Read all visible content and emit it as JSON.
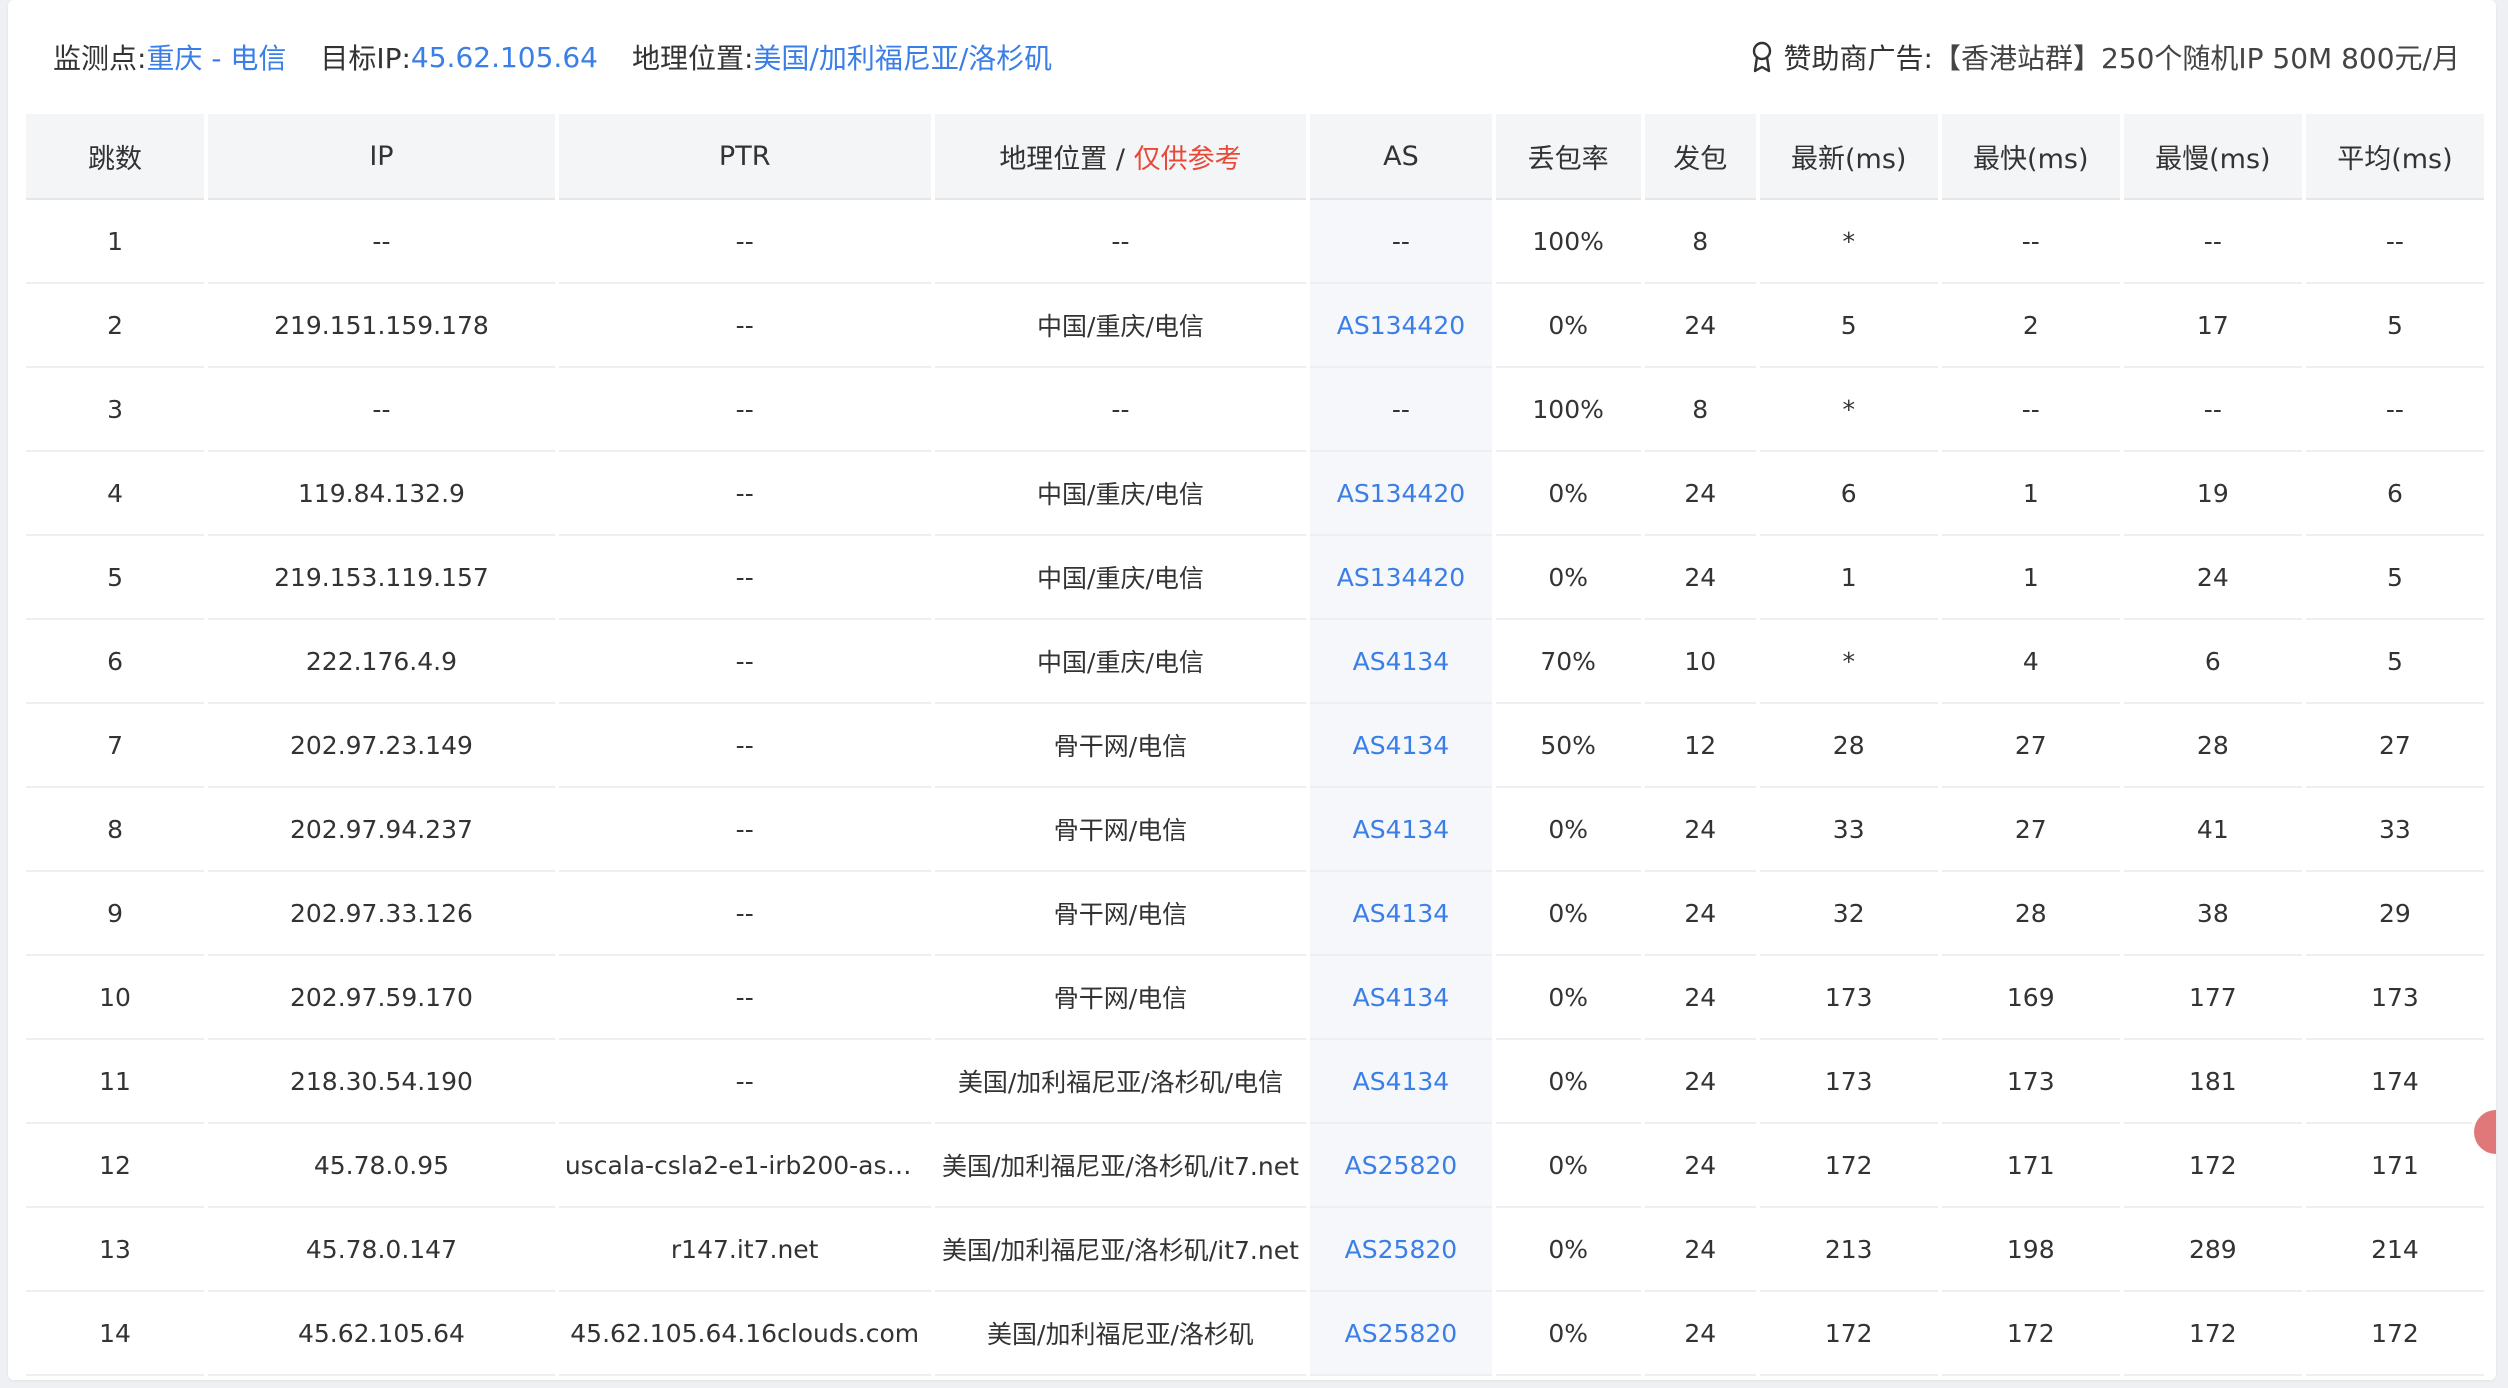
{
  "header": {
    "monitor_label": "监测点:",
    "monitor_value": "重庆 - 电信",
    "target_label": "目标IP:",
    "target_value": "45.62.105.64",
    "geo_label": "地理位置:",
    "geo_value": "美国/加利福尼亚/洛杉矶",
    "sponsor_label": "赞助商广告:",
    "sponsor_text": "【香港站群】250个随机IP 50M 800元/月",
    "icon": "award-icon"
  },
  "columns": {
    "hop": "跳数",
    "ip": "IP",
    "ptr": "PTR",
    "geo": "地理位置 / ",
    "geo_note": "仅供参考",
    "as": "AS",
    "loss": "丢包率",
    "sent": "发包",
    "last": "最新(ms)",
    "best": "最快(ms)",
    "worst": "最慢(ms)",
    "avg": "平均(ms)"
  },
  "colors": {
    "link": "#3a7ee8",
    "note_red": "#e84a3a"
  },
  "rows": [
    {
      "hop": "1",
      "ip": "--",
      "ptr": "--",
      "geo": "--",
      "as": "--",
      "as_link": false,
      "loss": "100%",
      "sent": "8",
      "last": "*",
      "best": "--",
      "worst": "--",
      "avg": "--"
    },
    {
      "hop": "2",
      "ip": "219.151.159.178",
      "ptr": "--",
      "geo": "中国/重庆/电信",
      "as": "AS134420",
      "as_link": true,
      "loss": "0%",
      "sent": "24",
      "last": "5",
      "best": "2",
      "worst": "17",
      "avg": "5"
    },
    {
      "hop": "3",
      "ip": "--",
      "ptr": "--",
      "geo": "--",
      "as": "--",
      "as_link": false,
      "loss": "100%",
      "sent": "8",
      "last": "*",
      "best": "--",
      "worst": "--",
      "avg": "--"
    },
    {
      "hop": "4",
      "ip": "119.84.132.9",
      "ptr": "--",
      "geo": "中国/重庆/电信",
      "as": "AS134420",
      "as_link": true,
      "loss": "0%",
      "sent": "24",
      "last": "6",
      "best": "1",
      "worst": "19",
      "avg": "6"
    },
    {
      "hop": "5",
      "ip": "219.153.119.157",
      "ptr": "--",
      "geo": "中国/重庆/电信",
      "as": "AS134420",
      "as_link": true,
      "loss": "0%",
      "sent": "24",
      "last": "1",
      "best": "1",
      "worst": "24",
      "avg": "5"
    },
    {
      "hop": "6",
      "ip": "222.176.4.9",
      "ptr": "--",
      "geo": "中国/重庆/电信",
      "as": "AS4134",
      "as_link": true,
      "loss": "70%",
      "sent": "10",
      "last": "*",
      "best": "4",
      "worst": "6",
      "avg": "5"
    },
    {
      "hop": "7",
      "ip": "202.97.23.149",
      "ptr": "--",
      "geo": "骨干网/电信",
      "as": "AS4134",
      "as_link": true,
      "loss": "50%",
      "sent": "12",
      "last": "28",
      "best": "27",
      "worst": "28",
      "avg": "27"
    },
    {
      "hop": "8",
      "ip": "202.97.94.237",
      "ptr": "--",
      "geo": "骨干网/电信",
      "as": "AS4134",
      "as_link": true,
      "loss": "0%",
      "sent": "24",
      "last": "33",
      "best": "27",
      "worst": "41",
      "avg": "33"
    },
    {
      "hop": "9",
      "ip": "202.97.33.126",
      "ptr": "--",
      "geo": "骨干网/电信",
      "as": "AS4134",
      "as_link": true,
      "loss": "0%",
      "sent": "24",
      "last": "32",
      "best": "28",
      "worst": "38",
      "avg": "29"
    },
    {
      "hop": "10",
      "ip": "202.97.59.170",
      "ptr": "--",
      "geo": "骨干网/电信",
      "as": "AS4134",
      "as_link": true,
      "loss": "0%",
      "sent": "24",
      "last": "173",
      "best": "169",
      "worst": "177",
      "avg": "173"
    },
    {
      "hop": "11",
      "ip": "218.30.54.190",
      "ptr": "--",
      "geo": "美国/加利福尼亚/洛杉矶/电信",
      "as": "AS4134",
      "as_link": true,
      "loss": "0%",
      "sent": "24",
      "last": "173",
      "best": "173",
      "worst": "181",
      "avg": "174"
    },
    {
      "hop": "12",
      "ip": "45.78.0.95",
      "ptr": "uscala-csla2-e1-irb200-as41...",
      "geo": "美国/加利福尼亚/洛杉矶/it7.net",
      "as": "AS25820",
      "as_link": true,
      "loss": "0%",
      "sent": "24",
      "last": "172",
      "best": "171",
      "worst": "172",
      "avg": "171"
    },
    {
      "hop": "13",
      "ip": "45.78.0.147",
      "ptr": "r147.it7.net",
      "geo": "美国/加利福尼亚/洛杉矶/it7.net",
      "as": "AS25820",
      "as_link": true,
      "loss": "0%",
      "sent": "24",
      "last": "213",
      "best": "198",
      "worst": "289",
      "avg": "214"
    },
    {
      "hop": "14",
      "ip": "45.62.105.64",
      "ptr": "45.62.105.64.16clouds.com",
      "geo": "美国/加利福尼亚/洛杉矶",
      "as": "AS25820",
      "as_link": true,
      "loss": "0%",
      "sent": "24",
      "last": "172",
      "best": "172",
      "worst": "172",
      "avg": "172"
    }
  ]
}
